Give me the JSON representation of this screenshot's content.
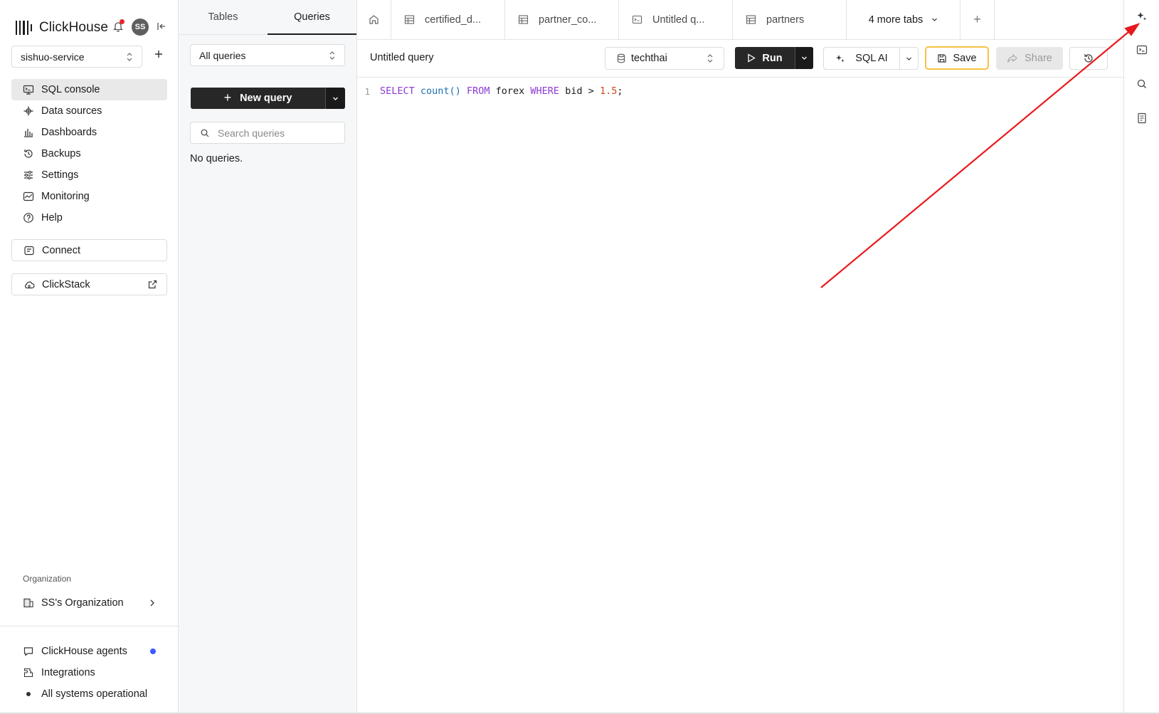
{
  "brand": {
    "name": "ClickHouse",
    "avatar_initials": "SS"
  },
  "service": {
    "name": "sishuo-service"
  },
  "nav": {
    "items": [
      {
        "label": "SQL console",
        "icon": "console-icon",
        "active": true
      },
      {
        "label": "Data sources",
        "icon": "data-sources-icon"
      },
      {
        "label": "Dashboards",
        "icon": "dashboards-icon"
      },
      {
        "label": "Backups",
        "icon": "backups-icon"
      },
      {
        "label": "Settings",
        "icon": "settings-icon"
      },
      {
        "label": "Monitoring",
        "icon": "monitoring-icon"
      },
      {
        "label": "Help",
        "icon": "help-icon"
      }
    ],
    "connect_label": "Connect",
    "clickstack_label": "ClickStack",
    "org_heading": "Organization",
    "org_name": "SS's Organization",
    "bottom": [
      {
        "label": "ClickHouse agents",
        "icon": "chat-icon"
      },
      {
        "label": "Integrations",
        "icon": "integrations-icon"
      },
      {
        "label": "All systems operational",
        "icon": "status-dot"
      }
    ]
  },
  "side2": {
    "tabs": [
      "Tables",
      "Queries"
    ],
    "active_tab": "Queries",
    "filter_value": "All queries",
    "new_query_label": "New query",
    "search_placeholder": "Search queries",
    "empty_text": "No queries."
  },
  "tabs": {
    "items": [
      {
        "label": "certified_d...",
        "icon": "table-icon"
      },
      {
        "label": "partner_co...",
        "icon": "table-icon"
      },
      {
        "label": "Untitled q...",
        "icon": "query-icon"
      },
      {
        "label": "partners",
        "icon": "table-icon"
      }
    ],
    "more_label": "4 more tabs",
    "add_label": "+"
  },
  "toolbar": {
    "query_title": "Untitled query",
    "database": "techthai",
    "run_label": "Run",
    "ai_label": "SQL AI",
    "save_label": "Save",
    "share_label": "Share"
  },
  "editor": {
    "line_number": "1",
    "tokens": {
      "t1": "SELECT",
      "t2": "count()",
      "t3": "FROM",
      "t4": "forex",
      "t5": "WHERE",
      "t6": "bid",
      "t7": ">",
      "t8": "1.5",
      "t9": ";"
    }
  },
  "colors": {
    "accent_save_border": "#f5c242",
    "notification_dot": "#e5252a",
    "agents_dot": "#3b5bff",
    "sql_keyword": "#8c3bd6",
    "sql_function": "#1f6fb2",
    "sql_number": "#d2471c",
    "annotation_arrow": "#e8191e"
  }
}
